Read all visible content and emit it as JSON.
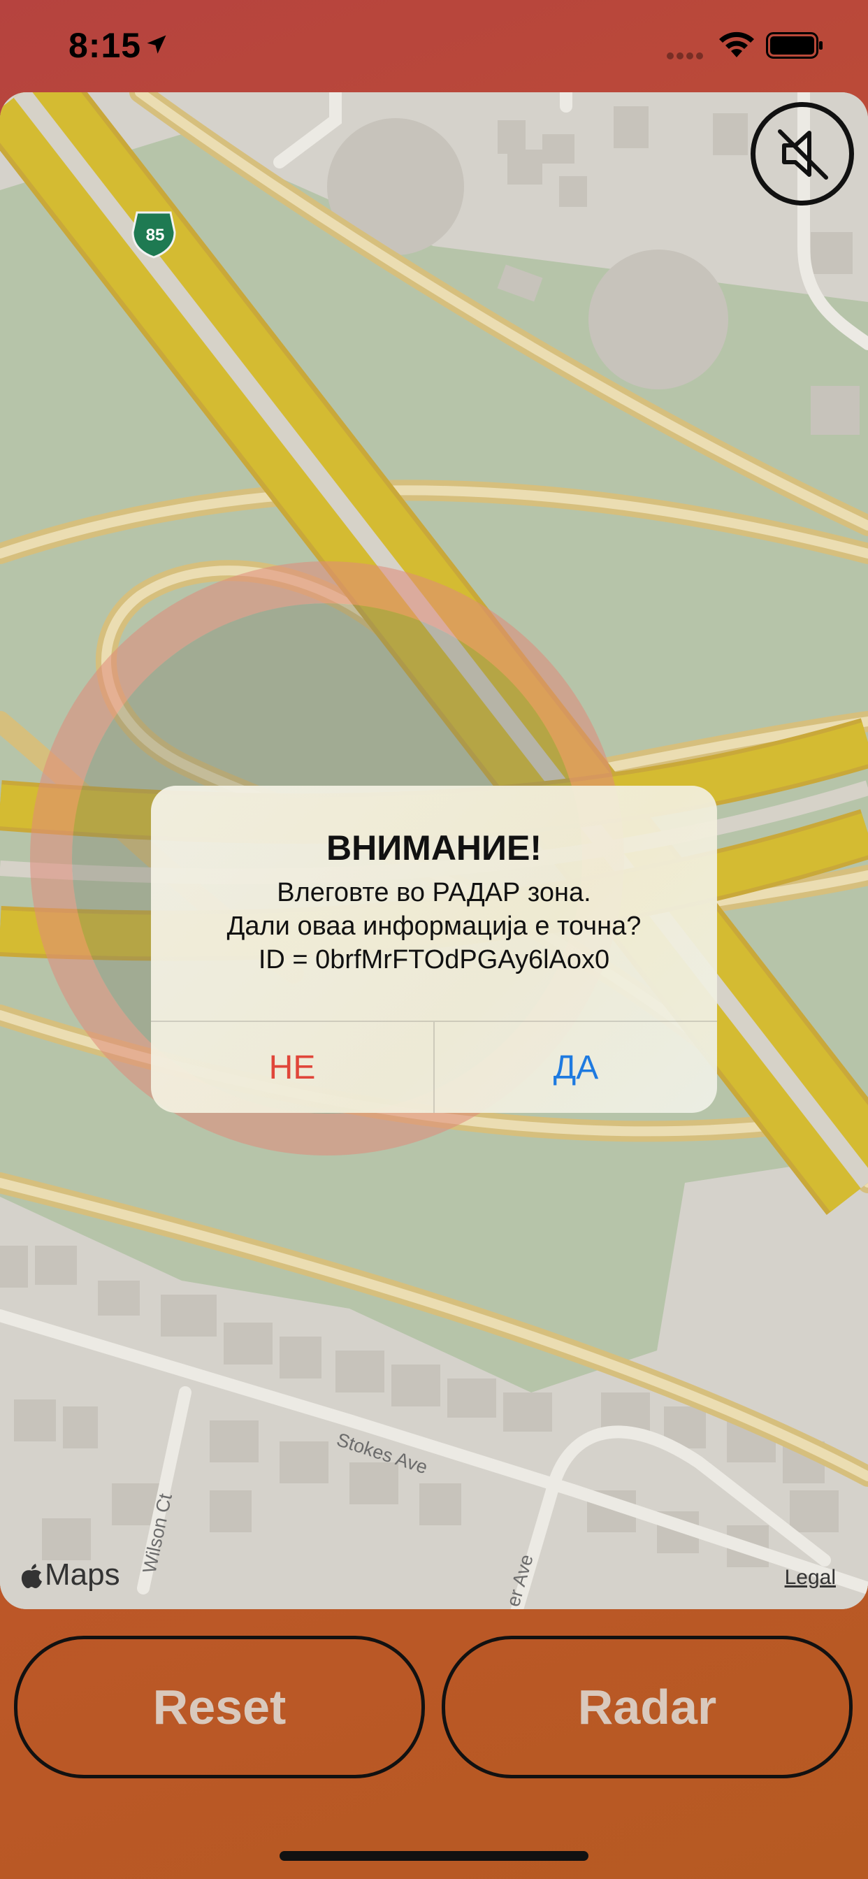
{
  "status_bar": {
    "time": "8:15",
    "icons": [
      "location-arrow-icon",
      "signal-icon",
      "wifi-icon",
      "battery-icon"
    ]
  },
  "map": {
    "attribution": "Maps",
    "legal_link": "Legal",
    "labels": {
      "highway_shield": "85",
      "street_1": "Stokes Ave",
      "street_2": "Wilson Ct",
      "street_3": "er Ave"
    },
    "mute_button_icon": "speaker-muted-icon",
    "radar_zone_color": "#e08a7a"
  },
  "alert": {
    "title": "ВНИМАНИЕ!",
    "message_lines": [
      "Влеговте во РАДАР зона.",
      "Дали оваа информација е точна?",
      "ID = 0brfMrFTOdPGAy6lAox0"
    ],
    "no_label": "НЕ",
    "yes_label": "ДА",
    "no_color": "#e0463a",
    "yes_color": "#1e7ae0"
  },
  "buttons": {
    "reset_label": "Reset",
    "radar_label": "Radar"
  }
}
